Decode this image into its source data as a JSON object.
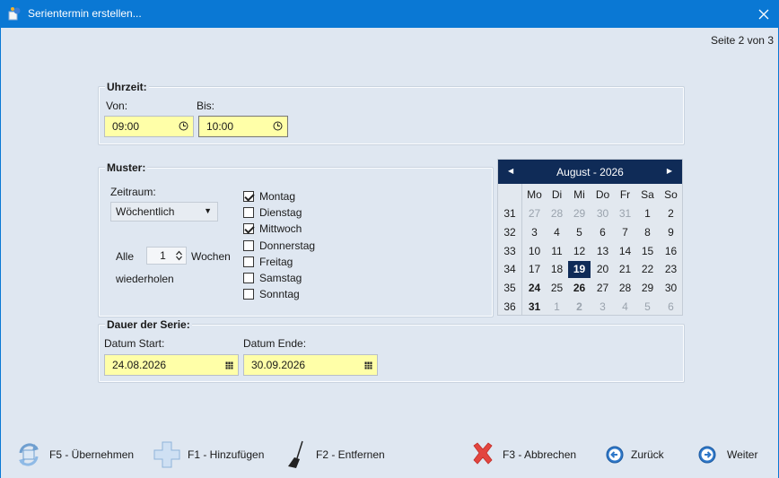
{
  "window": {
    "title": "Serientermin erstellen...",
    "page_indicator": "Seite 2 von 3"
  },
  "time": {
    "group_label": "Uhrzeit:",
    "from_label": "Von:",
    "from_value": "09:00",
    "to_label": "Bis:",
    "to_value": "10:00"
  },
  "pattern": {
    "group_label": "Muster:",
    "period_label": "Zeitraum:",
    "period_value": "Wöchentlich",
    "every_label": "Alle",
    "every_value": "1",
    "unit_label": "Wochen",
    "repeat_label": "wiederholen",
    "days": [
      {
        "label": "Montag",
        "checked": true
      },
      {
        "label": "Dienstag",
        "checked": false
      },
      {
        "label": "Mittwoch",
        "checked": true
      },
      {
        "label": "Donnerstag",
        "checked": false
      },
      {
        "label": "Freitag",
        "checked": false
      },
      {
        "label": "Samstag",
        "checked": false
      },
      {
        "label": "Sonntag",
        "checked": false
      }
    ]
  },
  "calendar": {
    "month_label": "August - 2026",
    "weekdays": [
      "Mo",
      "Di",
      "Mi",
      "Do",
      "Fr",
      "Sa",
      "So"
    ],
    "weeks": [
      "31",
      "32",
      "33",
      "34",
      "35",
      "36"
    ],
    "days": [
      [
        "27",
        "28",
        "29",
        "30",
        "31",
        "1",
        "2"
      ],
      [
        "3",
        "4",
        "5",
        "6",
        "7",
        "8",
        "9"
      ],
      [
        "10",
        "11",
        "12",
        "13",
        "14",
        "15",
        "16"
      ],
      [
        "17",
        "18",
        "19",
        "20",
        "21",
        "22",
        "23"
      ],
      [
        "24",
        "25",
        "26",
        "27",
        "28",
        "29",
        "30"
      ],
      [
        "31",
        "1",
        "2",
        "3",
        "4",
        "5",
        "6"
      ]
    ]
  },
  "duration": {
    "group_label": "Dauer der Serie:",
    "start_label": "Datum Start:",
    "start_value": "24.08.2026",
    "end_label": "Datum Ende:",
    "end_value": "30.09.2026"
  },
  "toolbar": {
    "apply": "F5 - Übernehmen",
    "add": "F1 - Hinzufügen",
    "remove": "F2 - Entfernen",
    "cancel": "F3 - Abbrechen",
    "back": "Zurück",
    "next": "Weiter"
  }
}
